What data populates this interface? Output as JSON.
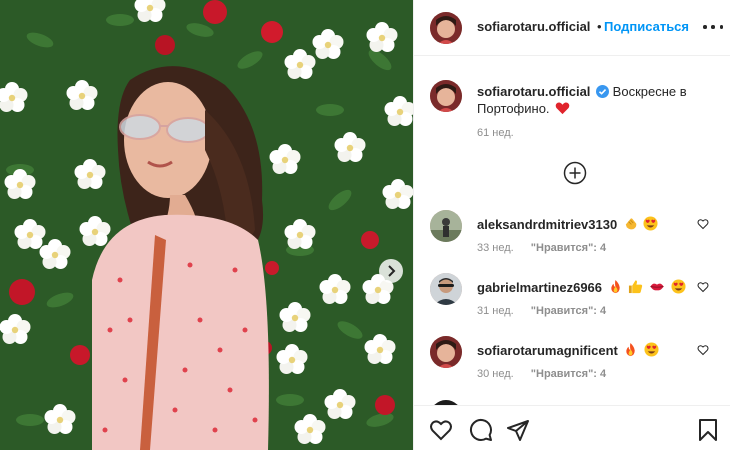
{
  "header": {
    "username": "sofiarotaru.official",
    "follow_label": "Подписаться",
    "more_icon": "more-horizontal-icon"
  },
  "caption": {
    "username": "sofiarotaru.official",
    "text": "Воскресне в Портофино.",
    "time": "61 нед."
  },
  "comments": [
    {
      "user": "aleksandrdmitriev3130",
      "time": "33 нед.",
      "likes": "\"Нравится\": 4",
      "emojis": [
        "clap",
        "heart-eyes"
      ]
    },
    {
      "user": "gabrielmartinez6966",
      "time": "31 нед.",
      "likes": "\"Нравится\": 4",
      "emojis": [
        "fire",
        "thumbs-up",
        "kiss-lips",
        "heart-eyes"
      ]
    },
    {
      "user": "sofiarotarumagnificent",
      "time": "30 нед.",
      "likes": "\"Нравится\": 4",
      "emojis": [
        "fire",
        "heart-eyes"
      ]
    }
  ],
  "colors": {
    "accent": "#0095f6",
    "verified": "#3897f0",
    "heart": "#ed4956",
    "muted": "#8e8e8e",
    "text": "#262626"
  }
}
